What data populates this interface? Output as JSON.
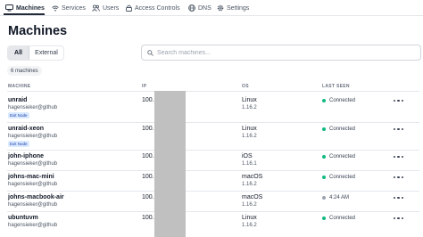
{
  "nav": {
    "items": [
      {
        "label": "Machines",
        "icon": "machines-icon",
        "active": true
      },
      {
        "label": "Services",
        "icon": "wifi-icon",
        "active": false
      },
      {
        "label": "Users",
        "icon": "users-icon",
        "active": false
      },
      {
        "label": "Access Controls",
        "icon": "lock-icon",
        "active": false
      },
      {
        "label": "DNS",
        "icon": "globe-icon",
        "active": false
      },
      {
        "label": "Settings",
        "icon": "gear-icon",
        "active": false
      }
    ]
  },
  "page": {
    "title": "Machines"
  },
  "filter": {
    "all_label": "All",
    "external_label": "External",
    "selected": "All"
  },
  "search": {
    "placeholder": "Search machines...",
    "value": ""
  },
  "count_label": "6 machines",
  "table": {
    "headers": {
      "machine": "MACHINE",
      "ip": "IP",
      "os": "OS",
      "last_seen": "LAST SEEN"
    },
    "rows": [
      {
        "name": "unraid",
        "owner": "hagensieker@github",
        "badge": "Exit Node",
        "ip": "100.1",
        "os": "Linux",
        "os_version": "1.16.2",
        "last_seen": "Connected",
        "status": "connected"
      },
      {
        "name": "unraid-xeon",
        "owner": "hagensieker@github",
        "badge": "Exit Node",
        "ip": "100.1",
        "os": "Linux",
        "os_version": "1.16.2",
        "last_seen": "Connected",
        "status": "connected"
      },
      {
        "name": "john-iphone",
        "owner": "hagensieker@github",
        "badge": "",
        "ip": "100.8",
        "os": "iOS",
        "os_version": "1.16.1",
        "last_seen": "Connected",
        "status": "connected"
      },
      {
        "name": "johns-mac-mini",
        "owner": "hagensieker@github",
        "badge": "",
        "ip": "100.1",
        "os": "macOS",
        "os_version": "1.16.2",
        "last_seen": "Connected",
        "status": "connected"
      },
      {
        "name": "johns-macbook-air",
        "owner": "hagensieker@github",
        "badge": "",
        "ip": "100.8",
        "os": "macOS",
        "os_version": "1.16.2",
        "last_seen": "4:24 AM",
        "status": "offline"
      },
      {
        "name": "ubuntuvm",
        "owner": "hagensieker@github",
        "badge": "",
        "ip": "100.9",
        "os": "Linux",
        "os_version": "1.16.2",
        "last_seen": "Connected",
        "status": "connected"
      }
    ]
  },
  "colors": {
    "connected": "#10b981",
    "offline": "#9ca3af",
    "badge_bg": "#dbeafe",
    "badge_text": "#1e40af"
  }
}
